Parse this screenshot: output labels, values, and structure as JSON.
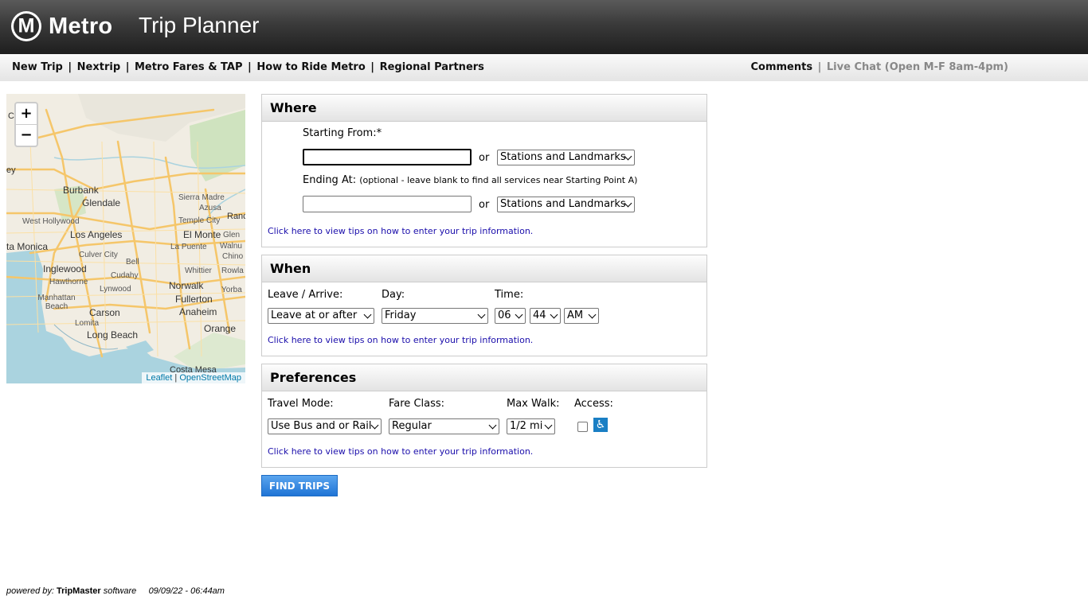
{
  "header": {
    "logo_letter": "M",
    "logo_text": "Metro",
    "app_title": "Trip Planner"
  },
  "nav": {
    "left": [
      "New Trip",
      "Nextrip",
      "Metro Fares & TAP",
      "How to Ride Metro",
      "Regional Partners"
    ],
    "separator": "|",
    "comments": "Comments",
    "live_chat": "Live Chat (Open M-F 8am-4pm)"
  },
  "map": {
    "zoom_in": "+",
    "zoom_out": "−",
    "attribution_leaflet": "Leaflet",
    "attribution_sep": "|",
    "attribution_osm": "OpenStreetMap",
    "places": [
      {
        "name": "Burbank"
      },
      {
        "name": "Glendale"
      },
      {
        "name": "Sierra Madre"
      },
      {
        "name": "Azusa"
      },
      {
        "name": "Temple City"
      },
      {
        "name": "Ranc"
      },
      {
        "name": "West Hollywood"
      },
      {
        "name": "Los Angeles"
      },
      {
        "name": "El Monte"
      },
      {
        "name": "Glen"
      },
      {
        "name": "La Puente"
      },
      {
        "name": "Walnu"
      },
      {
        "name": "ta Monica"
      },
      {
        "name": "Culver City"
      },
      {
        "name": "Chino"
      },
      {
        "name": "Bell"
      },
      {
        "name": "Inglewood"
      },
      {
        "name": "Cudahy"
      },
      {
        "name": "Whittier"
      },
      {
        "name": "Rowla"
      },
      {
        "name": "Hawthorne"
      },
      {
        "name": "Norwalk"
      },
      {
        "name": "Lynwood"
      },
      {
        "name": "Yorba"
      },
      {
        "name": "Manhattan Beach"
      },
      {
        "name": "Fullerton"
      },
      {
        "name": "Carson"
      },
      {
        "name": "Anaheim"
      },
      {
        "name": "Lomita"
      },
      {
        "name": "Orange"
      },
      {
        "name": "Long Beach"
      },
      {
        "name": "Costa Mesa"
      },
      {
        "name": "ey"
      },
      {
        "name": "C"
      }
    ]
  },
  "where": {
    "title": "Where",
    "starting_label": "Starting From:*",
    "starting_value": "",
    "or": "or",
    "start_select": "Stations and Landmarks",
    "ending_label": "Ending At:",
    "ending_hint": "(optional - leave blank to find all services near Starting Point A)",
    "ending_value": "",
    "end_select": "Stations and Landmarks",
    "tips": "Click here to view tips on how to enter your trip information."
  },
  "when": {
    "title": "When",
    "leave_label": "Leave / Arrive:",
    "day_label": "Day:",
    "time_label": "Time:",
    "leave_value": "Leave at or after",
    "day_value": "Friday",
    "hour": "06",
    "minute": "44",
    "ampm": "AM",
    "tips": "Click here to view tips on how to enter your trip information."
  },
  "preferences": {
    "title": "Preferences",
    "mode_label": "Travel Mode:",
    "fare_label": "Fare Class:",
    "walk_label": "Max Walk:",
    "access_label": "Access:",
    "mode_value": "Use Bus and or Rail",
    "fare_value": "Regular",
    "walk_value": "1/2 mi",
    "access_checked": false,
    "wheelchair_icon": "wheelchair-icon",
    "tips": "Click here to view tips on how to enter your trip information."
  },
  "find_button": "FIND TRIPS",
  "footer": {
    "powered_by": "powered by:",
    "brand": "TripMaster",
    "software": "software",
    "timestamp": "09/09/22 - 06:44am"
  },
  "colors": {
    "water": "#aad3df",
    "land": "#f1ede3",
    "road": "#f5c66a",
    "button": "#2a7fe0",
    "link": "#1a0dab"
  }
}
